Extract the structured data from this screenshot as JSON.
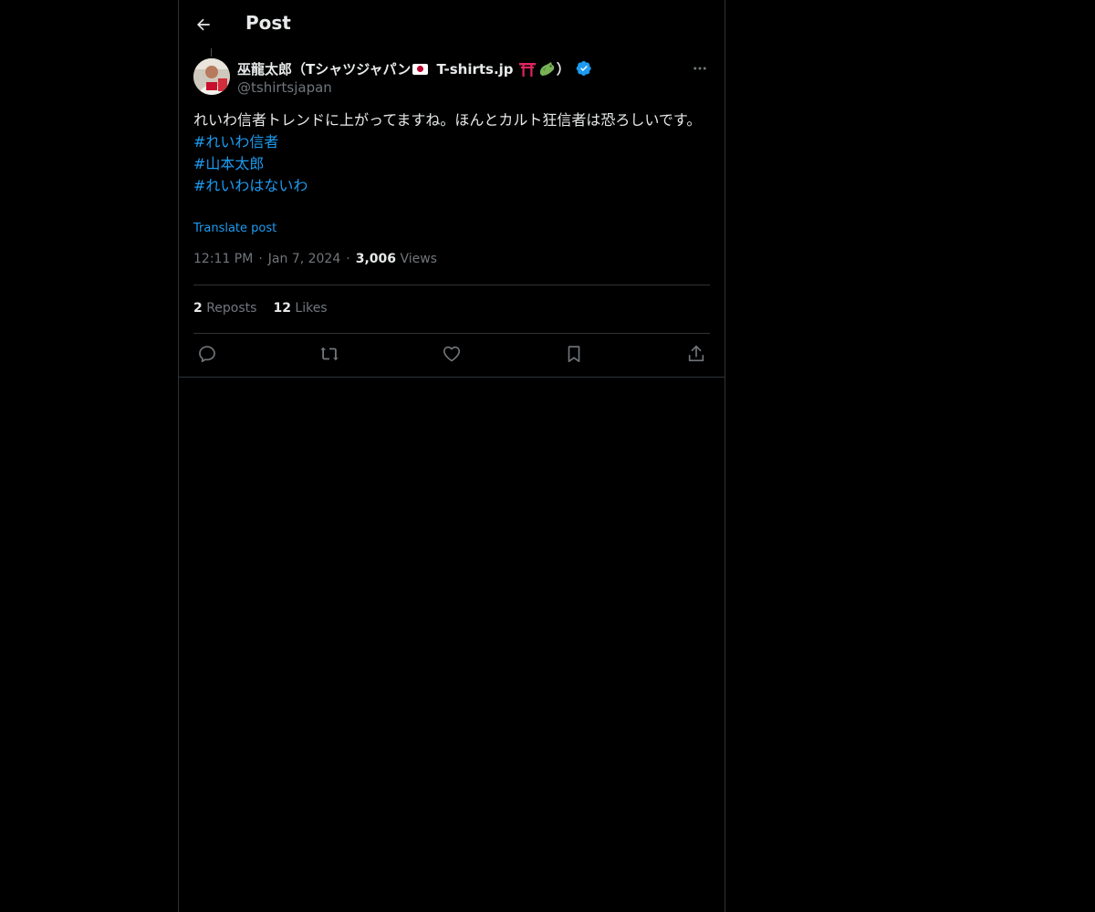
{
  "header": {
    "title": "Post"
  },
  "post": {
    "author": {
      "name_prefix": "巫龍太郎（Tシャツジャパン",
      "name_middle": " T-shirts.jp ",
      "name_suffix": "）",
      "handle": "@tshirtsjapan",
      "verified": true
    },
    "text": "れいわ信者トレンドに上がってますね。ほんとカルト狂信者は恐ろしいです。",
    "hashtags": [
      "#れいわ信者",
      "#山本太郎",
      "#れいわはないわ"
    ],
    "translate_label": "Translate post",
    "time": "12:11 PM",
    "date": "Jan 7, 2024",
    "views_count": "3,006",
    "views_label": "Views",
    "separator": "·",
    "reposts_count": "2",
    "reposts_label": "Reposts",
    "likes_count": "12",
    "likes_label": "Likes"
  },
  "colors": {
    "background": "#000000",
    "text": "#e7e9ea",
    "secondary": "#71767b",
    "accent": "#1d9bf0",
    "border": "#2f3336"
  },
  "icons": {
    "back": "arrow-left-icon",
    "more": "more-horizontal-icon",
    "verified": "verified-badge-icon",
    "reply": "reply-icon",
    "repost": "repost-icon",
    "like": "heart-icon",
    "bookmark": "bookmark-icon",
    "share": "share-icon"
  }
}
